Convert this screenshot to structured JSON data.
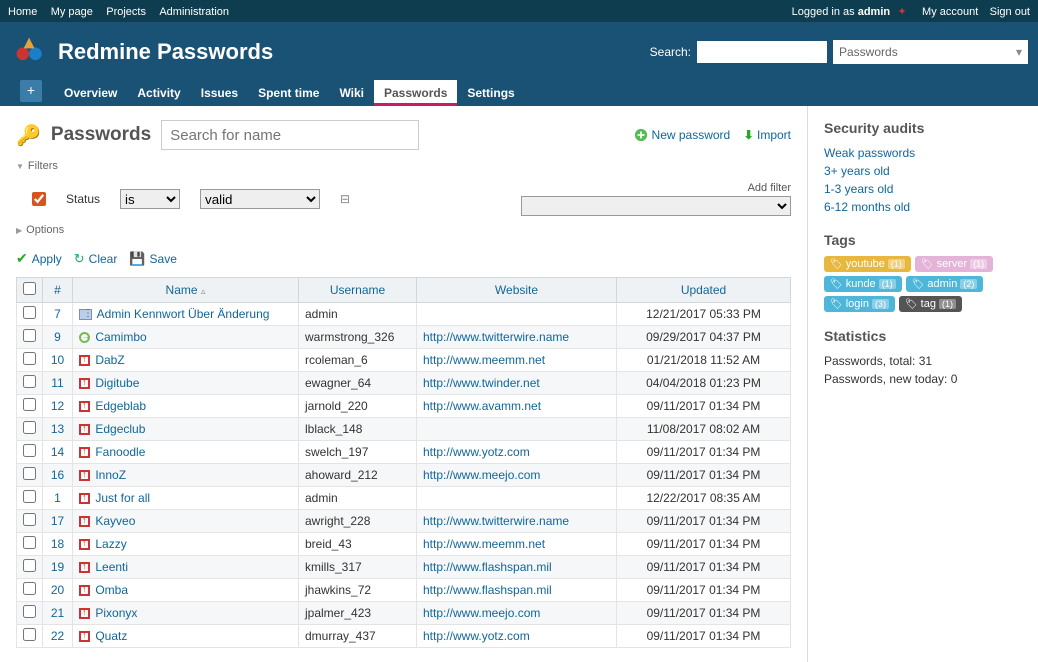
{
  "top": {
    "home": "Home",
    "mypage": "My page",
    "projects": "Projects",
    "admin": "Administration",
    "logged_in_prefix": "Logged in as ",
    "user": "admin",
    "my_account": "My account",
    "sign_out": "Sign out"
  },
  "header": {
    "title": "Redmine Passwords",
    "search_label": "Search:",
    "project_select": "Passwords"
  },
  "tabs": {
    "overview": "Overview",
    "activity": "Activity",
    "issues": "Issues",
    "spent": "Spent time",
    "wiki": "Wiki",
    "passwords": "Passwords",
    "settings": "Settings"
  },
  "main": {
    "title": "Passwords",
    "search_placeholder": "Search for name",
    "new_pw": "New password",
    "import": "Import",
    "filters": "Filters",
    "status": "Status",
    "op_is": "is",
    "val_valid": "valid",
    "add_filter": "Add filter",
    "options": "Options",
    "apply": "Apply",
    "clear": "Clear",
    "save": "Save",
    "cols": {
      "id": "#",
      "name": "Name",
      "user": "Username",
      "site": "Website",
      "upd": "Updated"
    },
    "rows": [
      {
        "id": "7",
        "icon": "blue",
        "name": "Admin Kennwort Über Änderung",
        "user": "admin",
        "site": "",
        "upd": "12/21/2017 05:33 PM"
      },
      {
        "id": "9",
        "icon": "green",
        "name": "Camimbo",
        "user": "warmstrong_326",
        "site": "http://www.twitterwire.name",
        "upd": "09/29/2017 04:37 PM"
      },
      {
        "id": "10",
        "icon": "red",
        "name": "DabZ",
        "user": "rcoleman_6",
        "site": "http://www.meemm.net",
        "upd": "01/21/2018 11:52 AM"
      },
      {
        "id": "11",
        "icon": "red",
        "name": "Digitube",
        "user": "ewagner_64",
        "site": "http://www.twinder.net",
        "upd": "04/04/2018 01:23 PM"
      },
      {
        "id": "12",
        "icon": "red",
        "name": "Edgeblab",
        "user": "jarnold_220",
        "site": "http://www.avamm.net",
        "upd": "09/11/2017 01:34 PM"
      },
      {
        "id": "13",
        "icon": "red",
        "name": "Edgeclub",
        "user": "lblack_148",
        "site": "",
        "upd": "11/08/2017 08:02 AM"
      },
      {
        "id": "14",
        "icon": "red",
        "name": "Fanoodle",
        "user": "swelch_197",
        "site": "http://www.yotz.com",
        "upd": "09/11/2017 01:34 PM"
      },
      {
        "id": "16",
        "icon": "red",
        "name": "InnoZ",
        "user": "ahoward_212",
        "site": "http://www.meejo.com",
        "upd": "09/11/2017 01:34 PM"
      },
      {
        "id": "1",
        "icon": "red",
        "name": "Just for all",
        "user": "admin",
        "site": "",
        "upd": "12/22/2017 08:35 AM"
      },
      {
        "id": "17",
        "icon": "red",
        "name": "Kayveo",
        "user": "awright_228",
        "site": "http://www.twitterwire.name",
        "upd": "09/11/2017 01:34 PM"
      },
      {
        "id": "18",
        "icon": "red",
        "name": "Lazzy",
        "user": "breid_43",
        "site": "http://www.meemm.net",
        "upd": "09/11/2017 01:34 PM"
      },
      {
        "id": "19",
        "icon": "red",
        "name": "Leenti",
        "user": "kmills_317",
        "site": "http://www.flashspan.mil",
        "upd": "09/11/2017 01:34 PM"
      },
      {
        "id": "20",
        "icon": "red",
        "name": "Omba",
        "user": "jhawkins_72",
        "site": "http://www.flashspan.mil",
        "upd": "09/11/2017 01:34 PM"
      },
      {
        "id": "21",
        "icon": "red",
        "name": "Pixonyx",
        "user": "jpalmer_423",
        "site": "http://www.meejo.com",
        "upd": "09/11/2017 01:34 PM"
      },
      {
        "id": "22",
        "icon": "red",
        "name": "Quatz",
        "user": "dmurray_437",
        "site": "http://www.yotz.com",
        "upd": "09/11/2017 01:34 PM"
      }
    ]
  },
  "sidebar": {
    "audits_title": "Security audits",
    "audits": [
      "Weak passwords",
      "3+ years old",
      "1-3 years old",
      "6-12 months old"
    ],
    "tags_title": "Tags",
    "tags": [
      {
        "label": "youtube",
        "cnt": "(1)",
        "color": "#e8b83e"
      },
      {
        "label": "server",
        "cnt": "(1)",
        "color": "#e3b3d8"
      },
      {
        "label": "kunde",
        "cnt": "(1)",
        "color": "#4eb6d9"
      },
      {
        "label": "admin",
        "cnt": "(2)",
        "color": "#4eb6d9"
      },
      {
        "label": "login",
        "cnt": "(3)",
        "color": "#4eb6d9"
      },
      {
        "label": "tag",
        "cnt": "(1)",
        "color": "#555"
      }
    ],
    "stats_title": "Statistics",
    "stats_total": "Passwords, total: 31",
    "stats_today": "Passwords, new today: 0"
  }
}
